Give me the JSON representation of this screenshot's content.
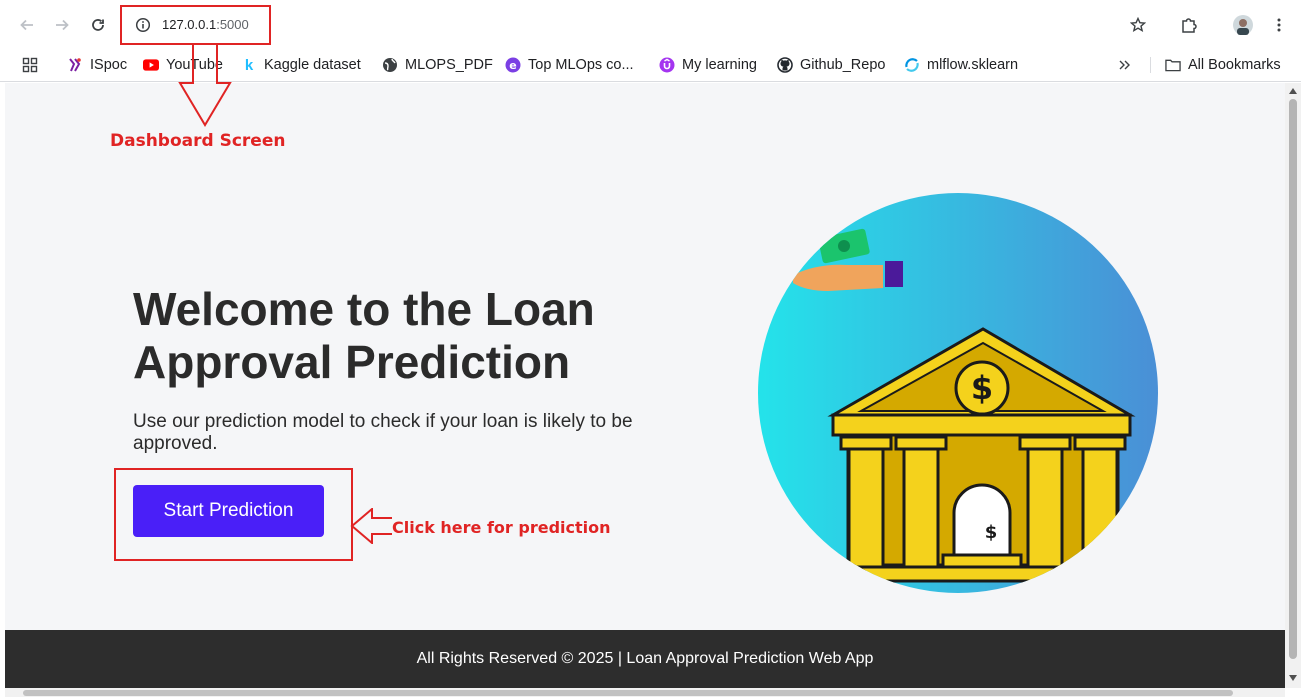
{
  "browser": {
    "url_host": "127.0.0.1",
    "url_port": ":5000",
    "bookmarks": [
      {
        "label": "ISpoc",
        "icon": "ispoc-icon",
        "color": "#7b1fa2"
      },
      {
        "label": "YouTube",
        "icon": "youtube-icon",
        "color": "#ff0000"
      },
      {
        "label": "Kaggle dataset",
        "icon": "kaggle-icon",
        "color": "#20beff"
      },
      {
        "label": "MLOPS_PDF",
        "icon": "globe-icon",
        "color": "#3c4043"
      },
      {
        "label": "Top MLOps co...",
        "icon": "edge-icon",
        "color": "#7b3fe4"
      },
      {
        "label": "My learning",
        "icon": "udemy-icon",
        "color": "#a435f0"
      },
      {
        "label": "Github_Repo",
        "icon": "github-icon",
        "color": "#24292f"
      },
      {
        "label": "mlflow.sklearn",
        "icon": "mlflow-icon",
        "color": "#0194e2"
      }
    ],
    "all_bookmarks_label": "All Bookmarks"
  },
  "page": {
    "title": "Welcome to the Loan Approval Prediction",
    "subtitle": "Use our prediction model to check if your loan is likely to be approved.",
    "cta_label": "Start Prediction",
    "footer_text": "All Rights Reserved © 2025 | Loan Approval Prediction Web App",
    "accent_color": "#4a1ff8"
  },
  "annotations": {
    "dashboard_label": "Dashboard Screen",
    "click_label": "Click here for prediction",
    "color": "#e02424"
  }
}
